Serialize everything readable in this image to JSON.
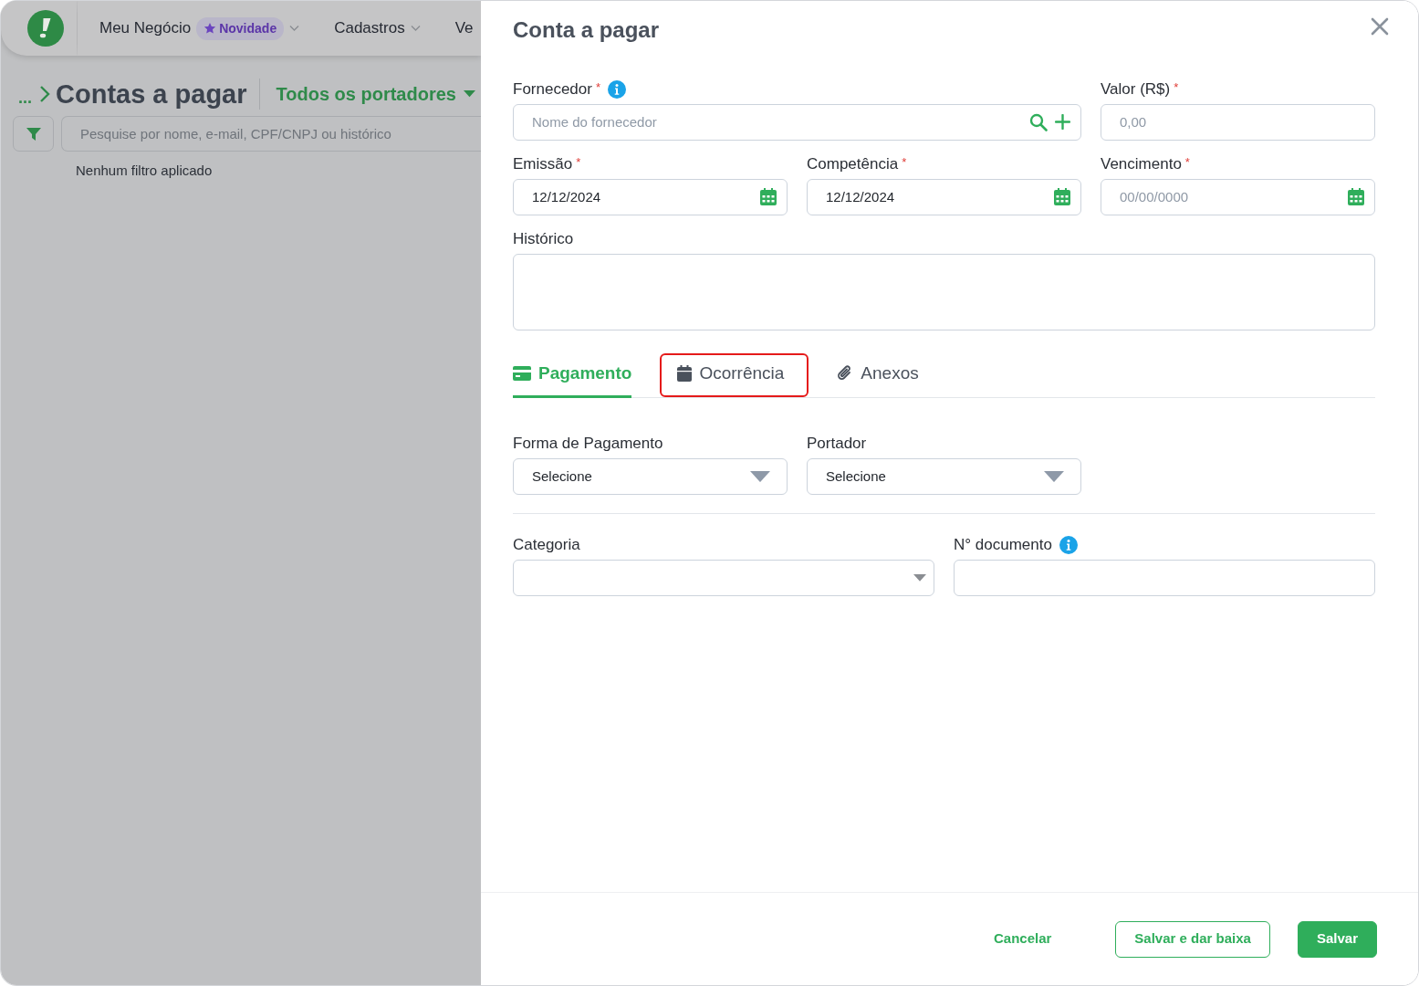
{
  "background_page": {
    "nav": [
      {
        "label": "Meu Negócio",
        "badge": "Novidade",
        "dropdown": true
      },
      {
        "label": "Cadastros",
        "dropdown": true
      },
      {
        "label": "Ve"
      }
    ],
    "breadcrumb": "...",
    "title": "Contas a pagar",
    "carrier_filter": "Todos os portadores",
    "search": {
      "placeholder": "Pesquise por nome, e-mail, CPF/CNPJ ou histórico"
    },
    "filter_status": "Nenhum filtro aplicado"
  },
  "drawer": {
    "title": "Conta a pagar",
    "fields": [
      {
        "label": "Fornecedor",
        "required_mark": "*",
        "info": true,
        "kind": "supplier",
        "placeholder": "Nome do fornecedor"
      },
      {
        "label": "Valor (R$)",
        "required_mark": "*",
        "kind": "text",
        "placeholder": "0,00"
      },
      {
        "label": "Emissão",
        "required_mark": "*",
        "kind": "date",
        "value": "12/12/2024"
      },
      {
        "label": "Competência",
        "required_mark": "*",
        "kind": "date",
        "value": "12/12/2024"
      },
      {
        "label": "Vencimento",
        "required_mark": "*",
        "kind": "date",
        "placeholder": "00/00/0000"
      },
      {
        "label": "Histórico",
        "kind": "textarea"
      }
    ],
    "tabs": [
      {
        "label": "Pagamento",
        "selected": true,
        "highlighted": false
      },
      {
        "label": "Ocorrência",
        "selected": false,
        "highlighted": true
      },
      {
        "label": "Anexos",
        "selected": false,
        "highlighted": false
      }
    ],
    "payment_fields": [
      {
        "label": "Forma de Pagamento",
        "kind": "select",
        "value": "Selecione"
      },
      {
        "label": "Portador",
        "kind": "select",
        "value": "Selecione"
      }
    ],
    "document_fields": [
      {
        "label": "Categoria",
        "kind": "combo"
      },
      {
        "label": "N° documento",
        "info": true,
        "kind": "text"
      }
    ],
    "buttons": [
      {
        "label": "Cancelar",
        "kind": "link"
      },
      {
        "label": "Salvar e dar baixa",
        "kind": "outline"
      },
      {
        "label": "Salvar",
        "kind": "primary"
      }
    ]
  }
}
